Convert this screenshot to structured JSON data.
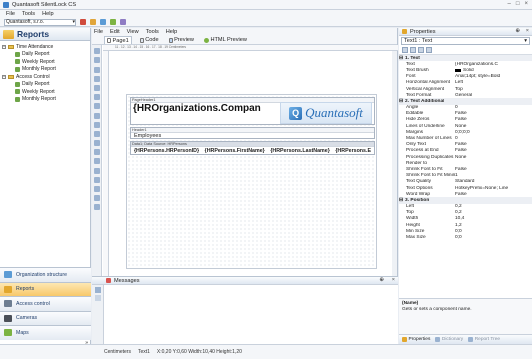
{
  "window": {
    "title": "Quantasoft SilentLock CS"
  },
  "menubar": {
    "items": [
      "File",
      "Tools",
      "Help"
    ]
  },
  "appbar": {
    "company_combo": "Quantasoft, s.r.o."
  },
  "nav": {
    "header": "Reports",
    "tree": [
      {
        "label": "Time Attendance",
        "level": 0,
        "expander": "−"
      },
      {
        "label": "Daily Report",
        "level": 1
      },
      {
        "label": "Weekly Report",
        "level": 1
      },
      {
        "label": "Monthly Report",
        "level": 1
      },
      {
        "label": "Access Control",
        "level": 0,
        "expander": "−"
      },
      {
        "label": "Daily Report",
        "level": 1
      },
      {
        "label": "Weekly Report",
        "level": 1
      },
      {
        "label": "Monthly Report",
        "level": 1
      }
    ],
    "buttons": [
      {
        "label": "Organization structure"
      },
      {
        "label": "Reports",
        "selected": true
      },
      {
        "label": "Access control"
      },
      {
        "label": "Cameras"
      },
      {
        "label": "Maps"
      }
    ]
  },
  "designer": {
    "menu": [
      "File",
      "Edit",
      "View",
      "Tools",
      "Help"
    ],
    "tabs": [
      "Page1",
      "Code",
      "Preview",
      "HTML Preview"
    ],
    "ruler": "11 . 12 . 13 . 14 . 15 . 16 . 17 . 18 . 19 Centimeters",
    "page_header_label": "PageHeader1",
    "org_text": "{HROrganizations.Compan",
    "logo_text": "Quantasoft",
    "header_label": "Header1",
    "employees": "Employees",
    "data_label": "Data1; Data Source: HRPersons",
    "data_fields": [
      "{HRPersons.HRPersonID}",
      "{HRPersons.FirstName}",
      "{HRPersons.LastName}",
      "{HRPersons.E"
    ]
  },
  "messages": {
    "title": "Messages"
  },
  "properties": {
    "title": "Properties",
    "selected": "Text1 : Text",
    "rows": [
      {
        "cat": true,
        "key": "1. Text"
      },
      {
        "key": "Text",
        "value": "{HROrganizations.C"
      },
      {
        "key": "Text Brush",
        "value": "Solid"
      },
      {
        "key": "Font",
        "value": "Arial;14pt; style=Bold"
      },
      {
        "key": "Horizontal Alignment",
        "value": "Left"
      },
      {
        "key": "Vertical Alignment",
        "value": "Top"
      },
      {
        "key": "Text Format",
        "value": "General"
      },
      {
        "cat": true,
        "key": "2. Text Additional"
      },
      {
        "key": "Angle",
        "value": "0"
      },
      {
        "key": "Editable",
        "value": "False"
      },
      {
        "key": "Hide Zeros",
        "value": "False"
      },
      {
        "key": "Lines of Underline",
        "value": "None"
      },
      {
        "key": "Margins",
        "value": "0;0;0;0"
      },
      {
        "key": "Max Number of Lines",
        "value": "0"
      },
      {
        "key": "Only Text",
        "value": "False"
      },
      {
        "key": "Process at End",
        "value": "False"
      },
      {
        "key": "Processing Duplicates",
        "value": "None"
      },
      {
        "key": "Render to",
        "value": ""
      },
      {
        "key": "Shrink Font to Fit",
        "value": "False"
      },
      {
        "key": "Shrink Font to Fit Minimu",
        "value": "1"
      },
      {
        "key": "Text Quality",
        "value": "Standard"
      },
      {
        "key": "Text Options",
        "value": "HotkeyPrefix=None; Line"
      },
      {
        "key": "Word Wrap",
        "value": "False"
      },
      {
        "cat": true,
        "key": "3. Position"
      },
      {
        "key": "Left",
        "value": "0,2"
      },
      {
        "key": "Top",
        "value": "0,2"
      },
      {
        "key": "Width",
        "value": "10,4"
      },
      {
        "key": "Height",
        "value": "1,2"
      },
      {
        "key": "Min Size",
        "value": "0;0"
      },
      {
        "key": "Max Size",
        "value": "0;0"
      }
    ],
    "desc_title": "(Name)",
    "desc_text": "Gets or sets a component name.",
    "footer_tabs": [
      "Properties",
      "Dictionary",
      "Report Tree"
    ]
  },
  "status": {
    "units": "Centimeters",
    "component": "Text1",
    "coords": "X:0,20 Y:0,60 Width:10,40 Height:1,20"
  },
  "colors": {
    "accent": "#2a6fb7",
    "nav_selected": "#f8c86a",
    "logo_blue": "#2a6fb7"
  }
}
